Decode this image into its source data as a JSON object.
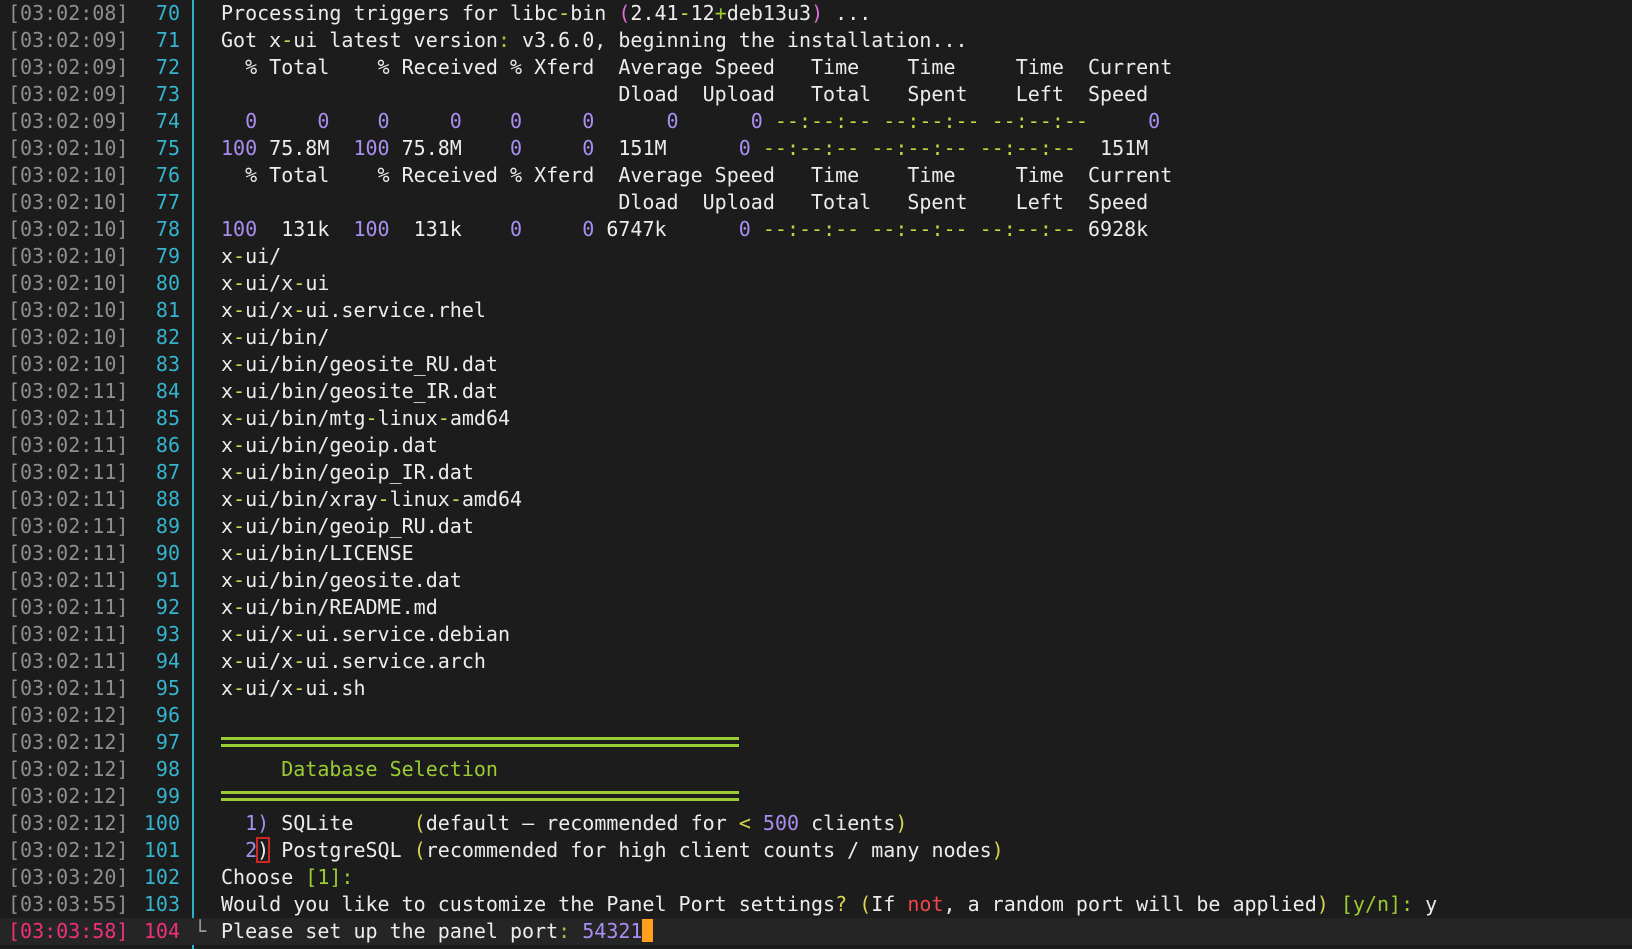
{
  "rows": [
    {
      "ts": "[03:02:08]",
      "ln": "70",
      "segs": [
        [
          "Processing triggers for libc",
          "t"
        ],
        [
          "-",
          "y"
        ],
        [
          "bin ",
          "t"
        ],
        [
          "(",
          "p"
        ],
        [
          "2.41",
          "t"
        ],
        [
          "-",
          "y"
        ],
        [
          "12",
          "t"
        ],
        [
          "+",
          "g"
        ],
        [
          "deb13u3",
          "t"
        ],
        [
          ")",
          "p"
        ],
        [
          " ...",
          "t"
        ]
      ]
    },
    {
      "ts": "[03:02:09]",
      "ln": "71",
      "segs": [
        [
          "Got x",
          "t"
        ],
        [
          "-",
          "y"
        ],
        [
          "ui latest version",
          "t"
        ],
        [
          ":",
          "g"
        ],
        [
          " v3.6.0, beginning the installation...",
          "t"
        ]
      ]
    },
    {
      "ts": "[03:02:09]",
      "ln": "72",
      "segs": [
        [
          "  % Total    % Received % Xferd  Average Speed   Time    Time     Time  Current",
          "t"
        ]
      ]
    },
    {
      "ts": "[03:02:09]",
      "ln": "73",
      "segs": [
        [
          "                                 Dload  Upload   Total   Spent    Left  Speed",
          "t"
        ]
      ]
    },
    {
      "ts": "[03:02:09]",
      "ln": "74",
      "segs": [
        [
          "  0     0    0     0    0     0      0      0 ",
          "m"
        ],
        [
          "--:--:-- --:--:-- --:--:--",
          "dash"
        ],
        [
          "     0",
          "m"
        ]
      ]
    },
    {
      "ts": "[03:02:10]",
      "ln": "75",
      "segs": [
        [
          "100",
          "m"
        ],
        [
          " 75.8M  ",
          "t"
        ],
        [
          "100",
          "m"
        ],
        [
          " 75.8M    ",
          "t"
        ],
        [
          "0     0",
          "m"
        ],
        [
          "  151M      ",
          "t"
        ],
        [
          "0",
          "m"
        ],
        [
          " ",
          "t"
        ],
        [
          "--:--:-- --:--:-- --:--:--",
          "dash"
        ],
        [
          "  151M",
          "t"
        ]
      ]
    },
    {
      "ts": "[03:02:10]",
      "ln": "76",
      "segs": [
        [
          "  % Total    % Received % Xferd  Average Speed   Time    Time     Time  Current",
          "t"
        ]
      ]
    },
    {
      "ts": "[03:02:10]",
      "ln": "77",
      "segs": [
        [
          "                                 Dload  Upload   Total   Spent    Left  Speed",
          "t"
        ]
      ]
    },
    {
      "ts": "[03:02:10]",
      "ln": "78",
      "segs": [
        [
          "100",
          "m"
        ],
        [
          "  131k  ",
          "t"
        ],
        [
          "100",
          "m"
        ],
        [
          "  131k    ",
          "t"
        ],
        [
          "0     0",
          "m"
        ],
        [
          " 6747k      ",
          "t"
        ],
        [
          "0",
          "m"
        ],
        [
          " ",
          "t"
        ],
        [
          "--:--:-- --:--:-- --:--:--",
          "dash"
        ],
        [
          " 6928k",
          "t"
        ]
      ]
    },
    {
      "ts": "[03:02:10]",
      "ln": "79",
      "segs": [
        [
          "x",
          "t"
        ],
        [
          "-",
          "y"
        ],
        [
          "ui/",
          "t"
        ]
      ]
    },
    {
      "ts": "[03:02:10]",
      "ln": "80",
      "segs": [
        [
          "x",
          "t"
        ],
        [
          "-",
          "y"
        ],
        [
          "ui/x",
          "t"
        ],
        [
          "-",
          "y"
        ],
        [
          "ui",
          "t"
        ]
      ]
    },
    {
      "ts": "[03:02:10]",
      "ln": "81",
      "segs": [
        [
          "x",
          "t"
        ],
        [
          "-",
          "y"
        ],
        [
          "ui/x",
          "t"
        ],
        [
          "-",
          "y"
        ],
        [
          "ui.service.rhel",
          "t"
        ]
      ]
    },
    {
      "ts": "[03:02:10]",
      "ln": "82",
      "segs": [
        [
          "x",
          "t"
        ],
        [
          "-",
          "y"
        ],
        [
          "ui/bin/",
          "t"
        ]
      ]
    },
    {
      "ts": "[03:02:10]",
      "ln": "83",
      "segs": [
        [
          "x",
          "t"
        ],
        [
          "-",
          "y"
        ],
        [
          "ui/bin/geosite_RU.dat",
          "t"
        ]
      ]
    },
    {
      "ts": "[03:02:11]",
      "ln": "84",
      "segs": [
        [
          "x",
          "t"
        ],
        [
          "-",
          "y"
        ],
        [
          "ui/bin/geosite_IR.dat",
          "t"
        ]
      ]
    },
    {
      "ts": "[03:02:11]",
      "ln": "85",
      "segs": [
        [
          "x",
          "t"
        ],
        [
          "-",
          "y"
        ],
        [
          "ui/bin/mtg",
          "t"
        ],
        [
          "-",
          "y"
        ],
        [
          "linux",
          "t"
        ],
        [
          "-",
          "y"
        ],
        [
          "amd64",
          "t"
        ]
      ]
    },
    {
      "ts": "[03:02:11]",
      "ln": "86",
      "segs": [
        [
          "x",
          "t"
        ],
        [
          "-",
          "y"
        ],
        [
          "ui/bin/geoip.dat",
          "t"
        ]
      ]
    },
    {
      "ts": "[03:02:11]",
      "ln": "87",
      "segs": [
        [
          "x",
          "t"
        ],
        [
          "-",
          "y"
        ],
        [
          "ui/bin/geoip_IR.dat",
          "t"
        ]
      ]
    },
    {
      "ts": "[03:02:11]",
      "ln": "88",
      "segs": [
        [
          "x",
          "t"
        ],
        [
          "-",
          "y"
        ],
        [
          "ui/bin/xray",
          "t"
        ],
        [
          "-",
          "y"
        ],
        [
          "linux",
          "t"
        ],
        [
          "-",
          "y"
        ],
        [
          "amd64",
          "t"
        ]
      ]
    },
    {
      "ts": "[03:02:11]",
      "ln": "89",
      "segs": [
        [
          "x",
          "t"
        ],
        [
          "-",
          "y"
        ],
        [
          "ui/bin/geoip_RU.dat",
          "t"
        ]
      ]
    },
    {
      "ts": "[03:02:11]",
      "ln": "90",
      "segs": [
        [
          "x",
          "t"
        ],
        [
          "-",
          "y"
        ],
        [
          "ui/bin/LICENSE",
          "t"
        ]
      ]
    },
    {
      "ts": "[03:02:11]",
      "ln": "91",
      "segs": [
        [
          "x",
          "t"
        ],
        [
          "-",
          "y"
        ],
        [
          "ui/bin/geosite.dat",
          "t"
        ]
      ]
    },
    {
      "ts": "[03:02:11]",
      "ln": "92",
      "segs": [
        [
          "x",
          "t"
        ],
        [
          "-",
          "y"
        ],
        [
          "ui/bin/README.md",
          "t"
        ]
      ]
    },
    {
      "ts": "[03:02:11]",
      "ln": "93",
      "segs": [
        [
          "x",
          "t"
        ],
        [
          "-",
          "y"
        ],
        [
          "ui/x",
          "t"
        ],
        [
          "-",
          "y"
        ],
        [
          "ui.service.debian",
          "t"
        ]
      ]
    },
    {
      "ts": "[03:02:11]",
      "ln": "94",
      "segs": [
        [
          "x",
          "t"
        ],
        [
          "-",
          "y"
        ],
        [
          "ui/x",
          "t"
        ],
        [
          "-",
          "y"
        ],
        [
          "ui.service.arch",
          "t"
        ]
      ]
    },
    {
      "ts": "[03:02:11]",
      "ln": "95",
      "segs": [
        [
          "x",
          "t"
        ],
        [
          "-",
          "y"
        ],
        [
          "ui/x",
          "t"
        ],
        [
          "-",
          "y"
        ],
        [
          "ui.sh",
          "t"
        ]
      ]
    },
    {
      "ts": "[03:02:12]",
      "ln": "96",
      "segs": []
    },
    {
      "ts": "[03:02:12]",
      "ln": "97",
      "sep": true,
      "segs": []
    },
    {
      "ts": "[03:02:12]",
      "ln": "98",
      "segs": [
        [
          "     Database Selection",
          "g"
        ]
      ]
    },
    {
      "ts": "[03:02:12]",
      "ln": "99",
      "sep": true,
      "segs": []
    },
    {
      "ts": "[03:02:12]",
      "ln": "100",
      "segs": [
        [
          "  ",
          "t"
        ],
        [
          "1)",
          "m"
        ],
        [
          " SQLite     ",
          "t"
        ],
        [
          "(",
          "y"
        ],
        [
          "default ",
          "t"
        ],
        [
          "—",
          "t"
        ],
        [
          " recommended for ",
          "t"
        ],
        [
          "<",
          "y"
        ],
        [
          " ",
          "t"
        ],
        [
          "500",
          "m"
        ],
        [
          " clients",
          "t"
        ],
        [
          ")",
          "y"
        ]
      ]
    },
    {
      "ts": "[03:02:12]",
      "ln": "101",
      "segs": [
        [
          "  ",
          "t"
        ],
        [
          "2",
          "m"
        ],
        [
          ")",
          "err"
        ],
        [
          " PostgreSQL ",
          "t"
        ],
        [
          "(",
          "y"
        ],
        [
          "recommended for high client counts / many nodes",
          "t"
        ],
        [
          ")",
          "y"
        ]
      ]
    },
    {
      "ts": "[03:03:20]",
      "ln": "102",
      "segs": [
        [
          "Choose ",
          "t"
        ],
        [
          "[1]",
          "g"
        ],
        [
          ":",
          "g"
        ]
      ]
    },
    {
      "ts": "[03:03:55]",
      "ln": "103",
      "segs": [
        [
          "Would you like to customize the Panel Port settings",
          "t"
        ],
        [
          "?",
          "y"
        ],
        [
          " ",
          "t"
        ],
        [
          "(",
          "y"
        ],
        [
          "If ",
          "t"
        ],
        [
          "not",
          "r"
        ],
        [
          ", a random port will be applied",
          "t"
        ],
        [
          ")",
          "y"
        ],
        [
          " ",
          "t"
        ],
        [
          "[y/n]",
          "g"
        ],
        [
          ":",
          "g"
        ],
        [
          " y",
          "t"
        ]
      ]
    },
    {
      "ts": "[03:03:58]",
      "ln": "104",
      "active": true,
      "hook": "└",
      "segs": [
        [
          "Please set up the panel port",
          "t"
        ],
        [
          ":",
          "g"
        ],
        [
          " ",
          "t"
        ],
        [
          "54321",
          "m"
        ]
      ]
    }
  ]
}
